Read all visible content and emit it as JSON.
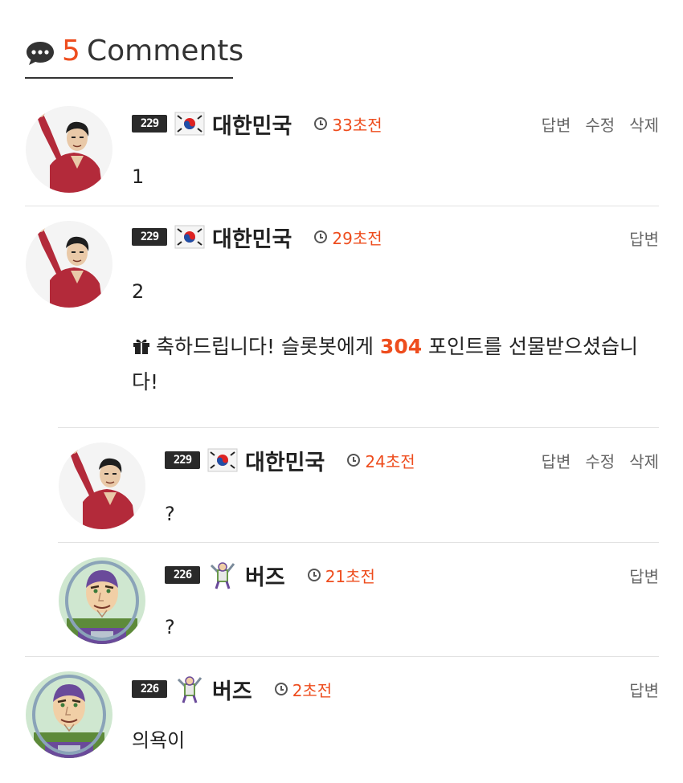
{
  "header": {
    "count": "5",
    "label": "Comments"
  },
  "comments": [
    {
      "level": "229",
      "nick": "대한민국",
      "time": "33초전",
      "actions": [
        "답변",
        "수정",
        "삭제"
      ],
      "text": "1"
    },
    {
      "level": "229",
      "nick": "대한민국",
      "time": "29초전",
      "actions": [
        "답변"
      ],
      "text": "2",
      "gift": {
        "before": "축하드립니다! 슬롯봇에게 ",
        "points": "304",
        "after": " 포인트를 선물받으셨습니다!"
      }
    },
    {
      "level": "229",
      "nick": "대한민국",
      "time": "24초전",
      "actions": [
        "답변",
        "수정",
        "삭제"
      ],
      "text": "?"
    },
    {
      "level": "226",
      "nick": "버즈",
      "time": "21초전",
      "actions": [
        "답변"
      ],
      "text": "?"
    },
    {
      "level": "226",
      "nick": "버즈",
      "time": "2초전",
      "actions": [
        "답변"
      ],
      "text": "의욕이"
    }
  ],
  "colors": {
    "accent": "#ee4d1e",
    "text": "#222222",
    "muted": "#666666",
    "divider": "#e2e2e2"
  }
}
